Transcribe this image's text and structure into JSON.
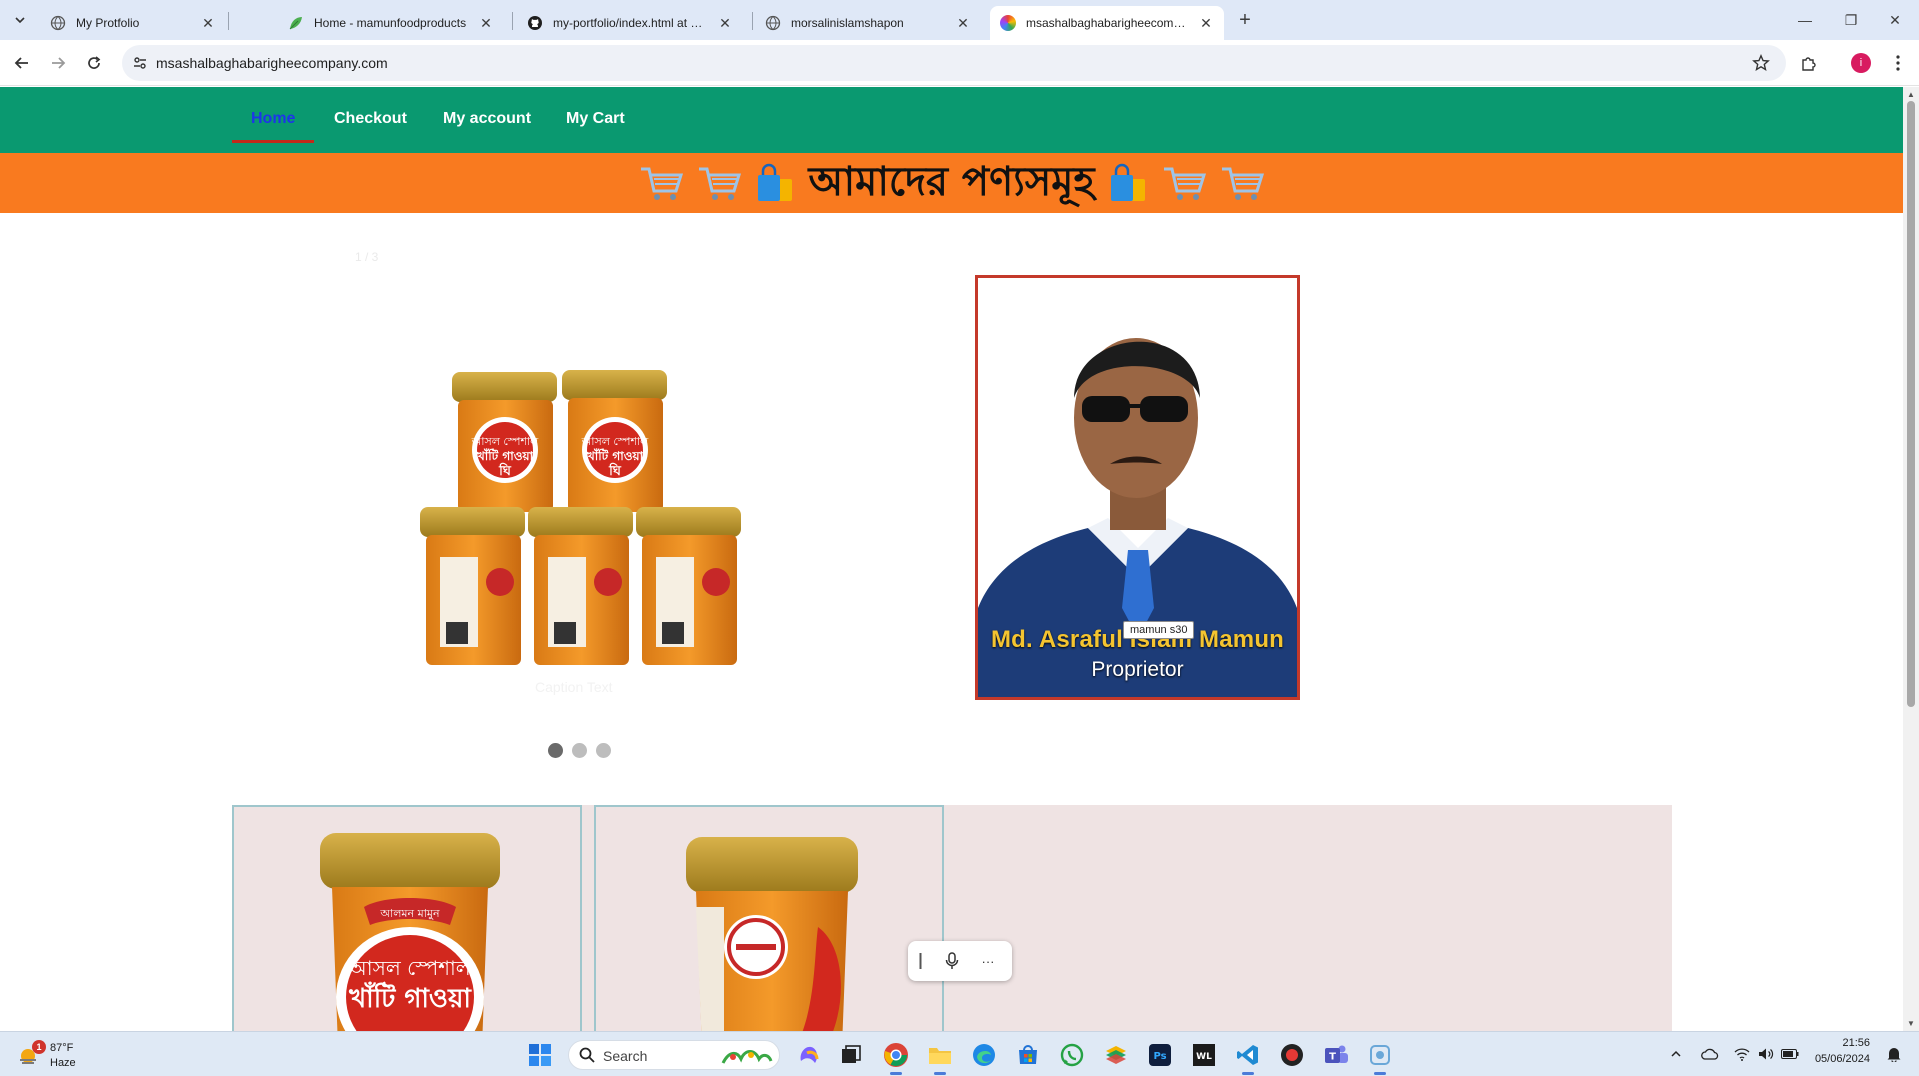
{
  "browser": {
    "tabs": [
      {
        "title": "My Protfolio"
      },
      {
        "title": "Home - mamunfoodproducts"
      },
      {
        "title": "my-portfolio/index.html at mai"
      },
      {
        "title": "morsalinislamshapon"
      },
      {
        "title": "msashalbaghabarigheecompan"
      }
    ],
    "active_tab": 4,
    "new_tab_symbol": "+",
    "close_symbol": "✕",
    "window_controls": {
      "minimize": "—",
      "restore": "❐",
      "close": "✕"
    },
    "url": "msashalbaghabarigheecompany.com",
    "profile_initial": "i"
  },
  "site": {
    "nav": [
      {
        "label": "Home",
        "active": true
      },
      {
        "label": "Checkout",
        "active": false
      },
      {
        "label": "My account",
        "active": false
      },
      {
        "label": "My Cart",
        "active": false
      }
    ],
    "banner_title": "আমাদের পণ্যসমূহ",
    "carousel": {
      "counter": "1 / 3",
      "caption": "Caption Text",
      "dots": 3,
      "active_dot": 0
    },
    "proprietor": {
      "name": "Md. Asraful Islam Mamun",
      "role": "Proprietor",
      "tooltip": "mamun s30"
    },
    "product_label_lines": [
      "আসল স্পেশাল",
      "খাঁটি গাওয়া",
      "ঘি"
    ],
    "product_brand": "আলমন মামুন"
  },
  "voice_bar": {
    "more": "···"
  },
  "taskbar": {
    "weather_badge": "1",
    "temperature": "87°F",
    "condition": "Haze",
    "search_label": "Search",
    "time": "21:56",
    "date": "05/06/2024"
  },
  "colors": {
    "nav_bg": "#0a9970",
    "banner_bg": "#f97a1f",
    "active_nav": "#1d35e8",
    "product_bg": "#efe3e3",
    "frame": "#c4392a"
  }
}
